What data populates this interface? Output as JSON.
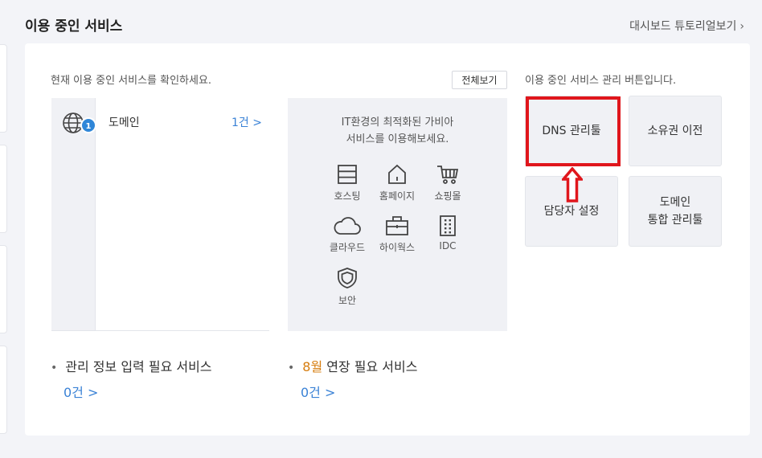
{
  "header": {
    "title": "이용 중인 서비스",
    "tutorial_link": "대시보드 튜토리얼보기",
    "chevron": "›"
  },
  "intro_text": "현재 이용 중인 서비스를 확인하세요.",
  "view_all_label": "전체보기",
  "management_text": "이용 중인 서비스 관리 버튼입니다.",
  "service_list": {
    "badge_count": "1",
    "icon": "globe-icon",
    "name": "도메인",
    "count_label": "1건 >"
  },
  "promo": {
    "text_line1": "IT환경의 최적화된 가비아",
    "text_line2": "서비스를 이용해보세요.",
    "items": [
      {
        "label": "호스팅",
        "icon": "server-icon"
      },
      {
        "label": "홈페이지",
        "icon": "house-icon"
      },
      {
        "label": "쇼핑몰",
        "icon": "cart-icon"
      },
      {
        "label": "클라우드",
        "icon": "cloud-icon"
      },
      {
        "label": "하이웍스",
        "icon": "briefcase-icon"
      },
      {
        "label": "IDC",
        "icon": "building-icon"
      },
      {
        "label": "보안",
        "icon": "shield-icon"
      }
    ]
  },
  "management_buttons": {
    "dns": "DNS 관리툴",
    "ownership": "소유권 이전",
    "contact": "담당자 설정",
    "domain_tool_line1": "도메인",
    "domain_tool_line2": "통합 관리툴"
  },
  "info_required": {
    "bullet": "•",
    "title": "관리 정보 입력 필요 서비스",
    "count_label": "0건 >"
  },
  "renewal": {
    "bullet": "•",
    "month": "8월",
    "title": " 연장 필요 서비스",
    "count_label": "0건 >"
  },
  "colors": {
    "accent_blue": "#3a82d6",
    "badge_blue": "#2f86d8",
    "highlight_red": "#e0161c",
    "month_orange": "#d67c0d"
  }
}
